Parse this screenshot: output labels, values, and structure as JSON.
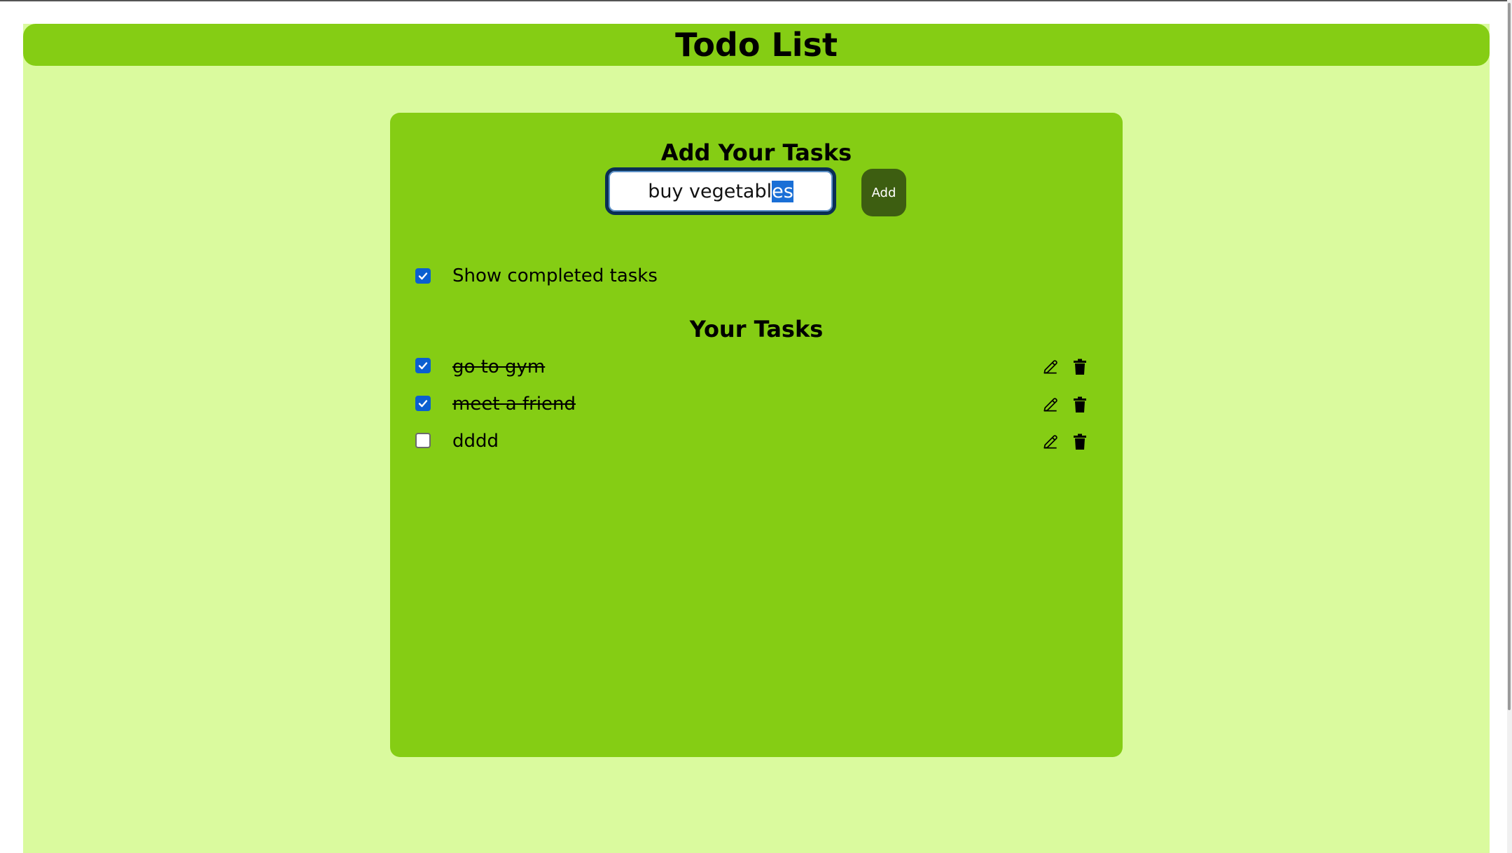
{
  "header": {
    "title": "Todo List"
  },
  "add_section": {
    "heading": "Add Your Tasks",
    "input_value_unselected": "buy vegetabl",
    "input_value_selected": "es",
    "add_label": "Add"
  },
  "filter": {
    "show_completed_label": "Show completed tasks",
    "show_completed_checked": true
  },
  "tasks_section": {
    "heading": "Your Tasks",
    "items": [
      {
        "text": "go to gym",
        "completed": true,
        "edit_icon": "pencil-icon",
        "delete_icon": "trash-icon"
      },
      {
        "text": "meet a friend",
        "completed": true,
        "edit_icon": "pencil-icon",
        "delete_icon": "trash-icon"
      },
      {
        "text": "dddd",
        "completed": false,
        "edit_icon": "pencil-icon",
        "delete_icon": "trash-icon"
      }
    ]
  },
  "colors": {
    "page_background": "#dafa9e",
    "accent_green": "#85cd14",
    "add_button": "#3d5e11",
    "checkbox_blue": "#0b5fd0",
    "selection": "#1a6fd6"
  }
}
